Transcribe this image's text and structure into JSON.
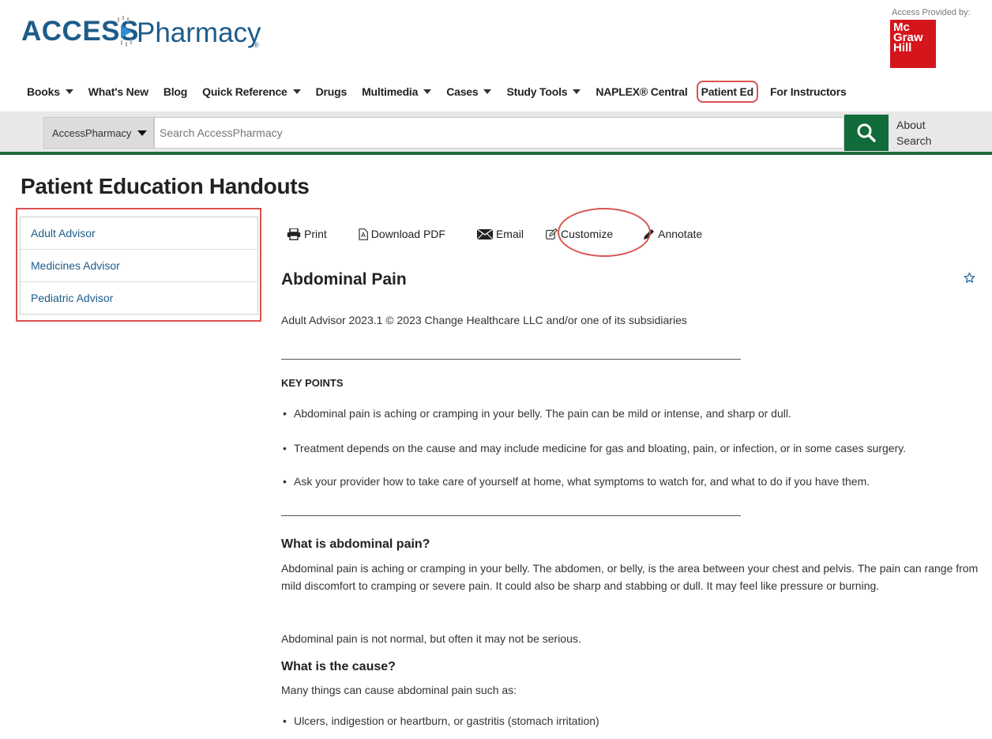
{
  "header": {
    "logo_access": "ACCESS",
    "logo_pharmacy": "Pharmacy",
    "logo_reg": "®",
    "provided_by": "Access Provided by:",
    "publisher_logo_text": "Mc Graw Hill"
  },
  "nav": {
    "items": [
      {
        "label": "Books",
        "dropdown": true
      },
      {
        "label": "What's New",
        "dropdown": false
      },
      {
        "label": "Blog",
        "dropdown": false
      },
      {
        "label": "Quick Reference",
        "dropdown": true
      },
      {
        "label": "Drugs",
        "dropdown": false
      },
      {
        "label": "Multimedia",
        "dropdown": true
      },
      {
        "label": "Cases",
        "dropdown": true
      },
      {
        "label": "Study Tools",
        "dropdown": true
      },
      {
        "label": "NAPLEX® Central",
        "dropdown": false
      },
      {
        "label": "Patient Ed",
        "dropdown": false,
        "highlighted": true
      },
      {
        "label": "For Instructors",
        "dropdown": false
      }
    ]
  },
  "search": {
    "scope": "AccessPharmacy",
    "placeholder": "Search AccessPharmacy",
    "about_label": "About Search",
    "button_color": "#116b3a"
  },
  "page": {
    "title": "Patient Education Handouts"
  },
  "sidebar": {
    "items": [
      {
        "label": "Adult Advisor"
      },
      {
        "label": "Medicines Advisor"
      },
      {
        "label": "Pediatric Advisor"
      }
    ]
  },
  "toolbar": {
    "print": "Print",
    "download": "Download PDF",
    "email": "Email",
    "customize": "Customize",
    "annotate": "Annotate"
  },
  "article": {
    "title": "Abdominal Pain",
    "copyright": "Adult Advisor 2023.1 © 2023 Change Healthcare LLC and/or one of its subsidiaries",
    "key_points_heading": "KEY POINTS",
    "key_points": [
      "Abdominal pain is aching or cramping in your belly. The pain can be mild or intense, and sharp or dull.",
      "Treatment depends on the cause and may include medicine for gas and bloating, pain, or infection, or in some cases surgery.",
      "Ask your provider how to take care of yourself at home, what symptoms to watch for, and what to do if you have them."
    ],
    "section1_heading": "What is abdominal pain?",
    "section1_para1": "Abdominal pain is aching or cramping in your belly. The abdomen, or belly, is the area between your chest and pelvis. The pain can range from mild discomfort to cramping or severe pain. It could also be sharp and stabbing or dull. It may feel like pressure or burning.",
    "section1_para2": "Abdominal pain is not normal, but often it may not be serious.",
    "section2_heading": "What is the cause?",
    "section2_intro": "Many things can cause abdominal pain such as:",
    "causes": [
      "Ulcers, indigestion or heartburn, or gastritis (stomach irritation)"
    ]
  },
  "colors": {
    "brand_blue": "#1d5c8a",
    "highlight_red": "#d9534f",
    "green": "#116b3a",
    "publisher_red": "#d4151b"
  }
}
